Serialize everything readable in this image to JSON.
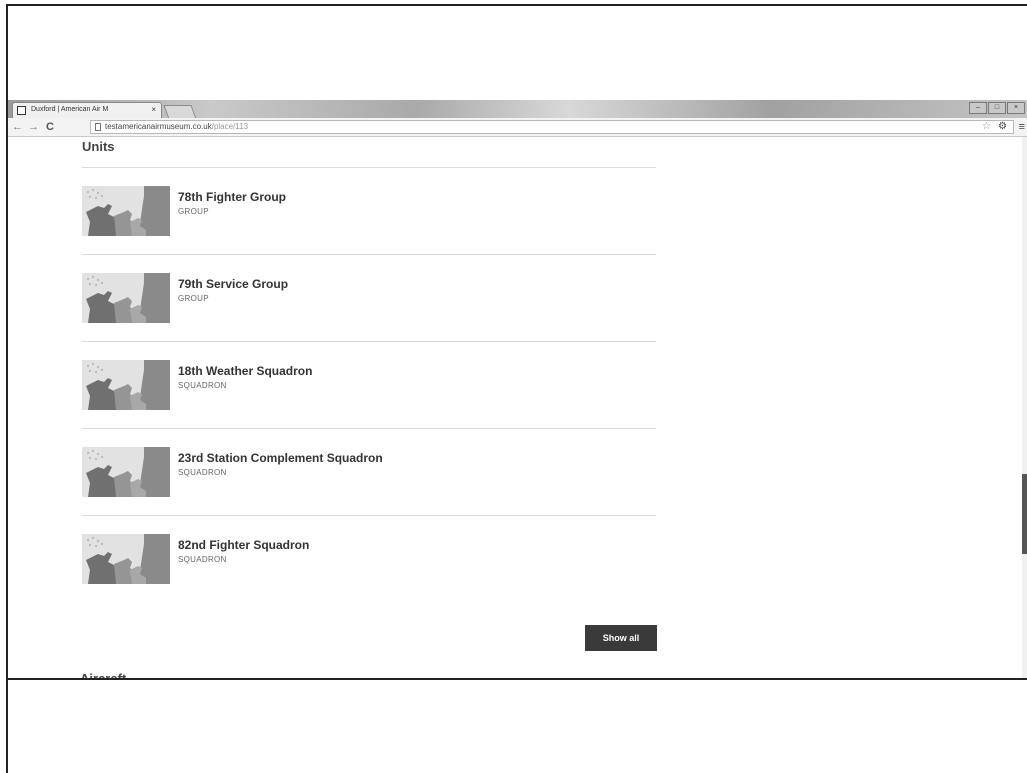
{
  "browser": {
    "tab_title": "Duxford | American Air M",
    "tab_close": "×",
    "window_controls": [
      "–",
      "□",
      "×"
    ],
    "nav": {
      "back": "←",
      "forward": "→",
      "reload": "C"
    },
    "url_host": "testamericanairmuseum.co.uk",
    "url_path": "/place/113",
    "icons": [
      "page-icon",
      "star-icon",
      "gear-icon",
      "menu-icon"
    ],
    "star": "☆",
    "gear": "⚙",
    "menu": "≡"
  },
  "page": {
    "units_title": "Units",
    "units": [
      {
        "name": "78th Fighter Group",
        "type": "GROUP"
      },
      {
        "name": "79th Service Group",
        "type": "GROUP"
      },
      {
        "name": "18th Weather Squadron",
        "type": "SQUADRON"
      },
      {
        "name": "23rd Station Complement Squadron",
        "type": "SQUADRON"
      },
      {
        "name": "82nd Fighter Squadron",
        "type": "SQUADRON"
      }
    ],
    "show_all_label": "Show all",
    "aircraft_title": "Aircraft"
  }
}
